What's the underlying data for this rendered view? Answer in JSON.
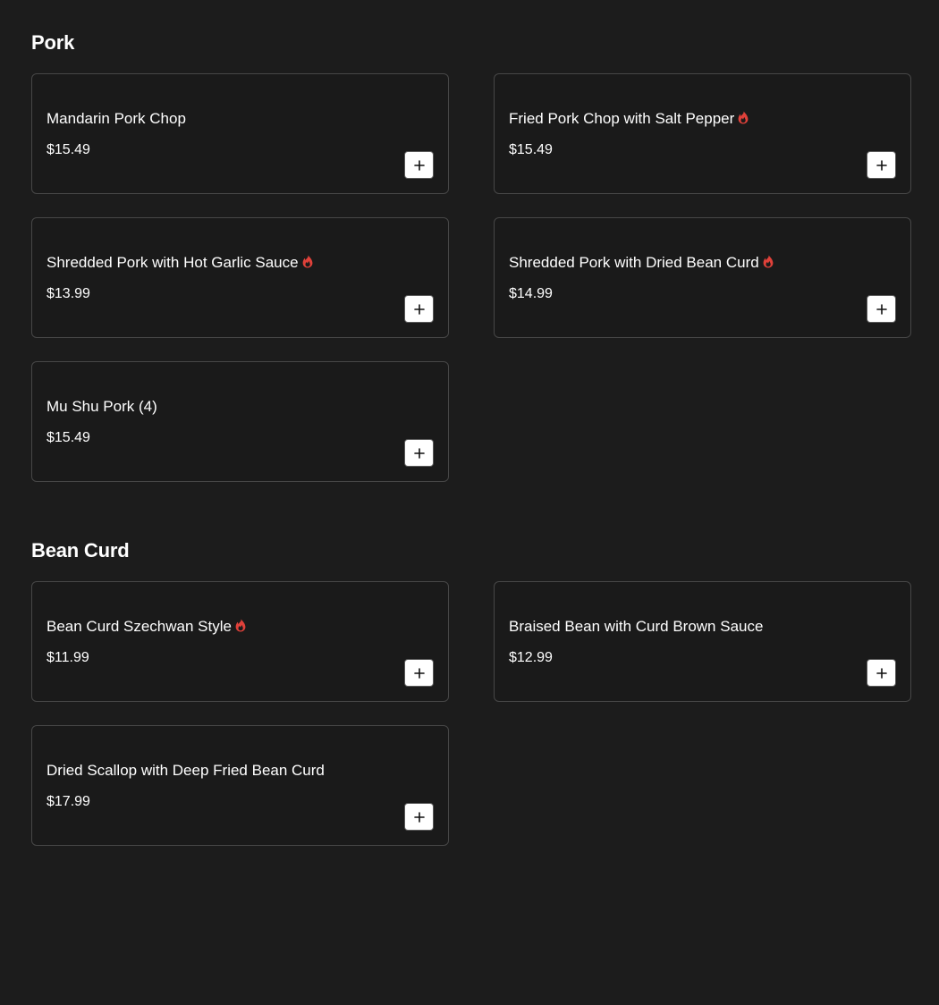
{
  "sections": [
    {
      "title": "Pork",
      "items": [
        {
          "name": "Mandarin Pork Chop",
          "price": "$15.49",
          "spicy": false
        },
        {
          "name": "Fried Pork Chop with Salt Pepper",
          "price": "$15.49",
          "spicy": true
        },
        {
          "name": "Shredded Pork with Hot Garlic Sauce",
          "price": "$13.99",
          "spicy": true
        },
        {
          "name": "Shredded Pork with Dried Bean Curd",
          "price": "$14.99",
          "spicy": true
        },
        {
          "name": "Mu Shu Pork (4)",
          "price": "$15.49",
          "spicy": false
        }
      ]
    },
    {
      "title": "Bean Curd",
      "items": [
        {
          "name": "Bean Curd Szechwan Style",
          "price": "$11.99",
          "spicy": true
        },
        {
          "name": "Braised Bean with Curd Brown Sauce",
          "price": "$12.99",
          "spicy": false
        },
        {
          "name": "Dried Scallop with Deep Fried Bean Curd",
          "price": "$17.99",
          "spicy": false
        }
      ]
    }
  ],
  "icons": {
    "spicy": "flame-icon",
    "add": "plus-icon"
  },
  "colors": {
    "background": "#1c1c1c",
    "card_border": "#474747",
    "spicy": "#e0413a",
    "add_button_bg": "#ffffff"
  }
}
